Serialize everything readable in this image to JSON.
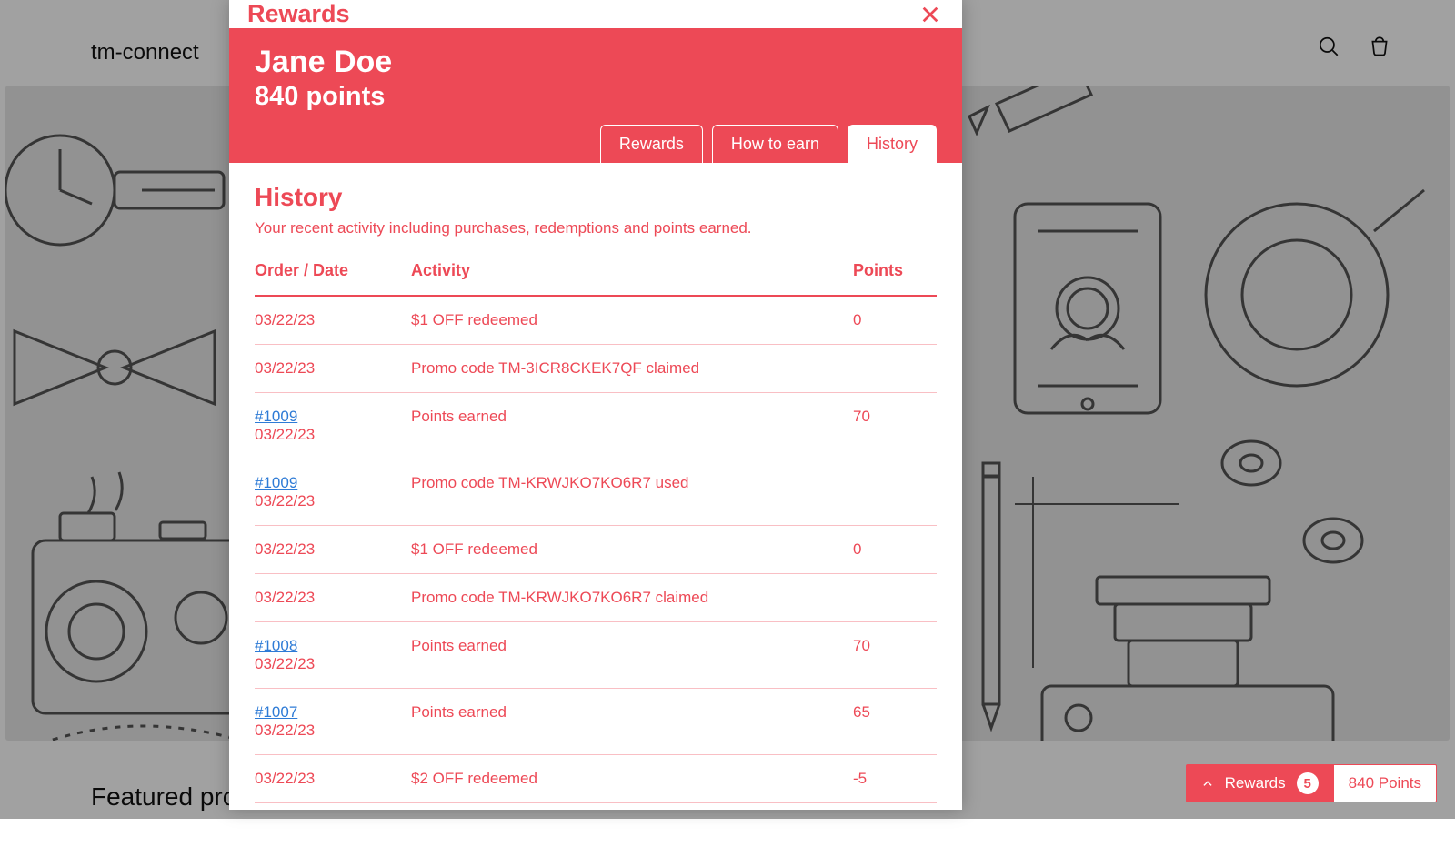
{
  "colors": {
    "accent": "#ed4956",
    "link": "#2e7bd6"
  },
  "store": {
    "brand": "tm-connect",
    "featured_heading": "Featured prod",
    "icons": {
      "search": "search-icon",
      "cart": "cart-icon"
    }
  },
  "widget": {
    "label": "Rewards",
    "badge_count": "5",
    "points_label": "840 Points"
  },
  "modal": {
    "title": "Rewards",
    "user_name": "Jane Doe",
    "points_line": "840 points",
    "tabs": [
      {
        "id": "rewards",
        "label": "Rewards",
        "active": false
      },
      {
        "id": "howtoearn",
        "label": "How to earn",
        "active": false
      },
      {
        "id": "history",
        "label": "History",
        "active": true
      }
    ],
    "panel_heading": "History",
    "panel_sub": "Your recent activity including purchases, redemptions and points earned.",
    "columns": {
      "order": "Order / Date",
      "activity": "Activity",
      "points": "Points"
    },
    "rows": [
      {
        "order": "",
        "date": "03/22/23",
        "activity": "$1 OFF redeemed",
        "points": "0"
      },
      {
        "order": "",
        "date": "03/22/23",
        "activity": "Promo code TM-3ICR8CKEK7QF claimed",
        "points": ""
      },
      {
        "order": "#1009",
        "date": "03/22/23",
        "activity": "Points earned",
        "points": "70"
      },
      {
        "order": "#1009",
        "date": "03/22/23",
        "activity": "Promo code TM-KRWJKO7KO6R7 used",
        "points": ""
      },
      {
        "order": "",
        "date": "03/22/23",
        "activity": "$1 OFF redeemed",
        "points": "0"
      },
      {
        "order": "",
        "date": "03/22/23",
        "activity": "Promo code TM-KRWJKO7KO6R7 claimed",
        "points": ""
      },
      {
        "order": "#1008",
        "date": "03/22/23",
        "activity": "Points earned",
        "points": "70"
      },
      {
        "order": "#1007",
        "date": "03/22/23",
        "activity": "Points earned",
        "points": "65"
      },
      {
        "order": "",
        "date": "03/22/23",
        "activity": "$2 OFF redeemed",
        "points": "-5"
      }
    ]
  }
}
